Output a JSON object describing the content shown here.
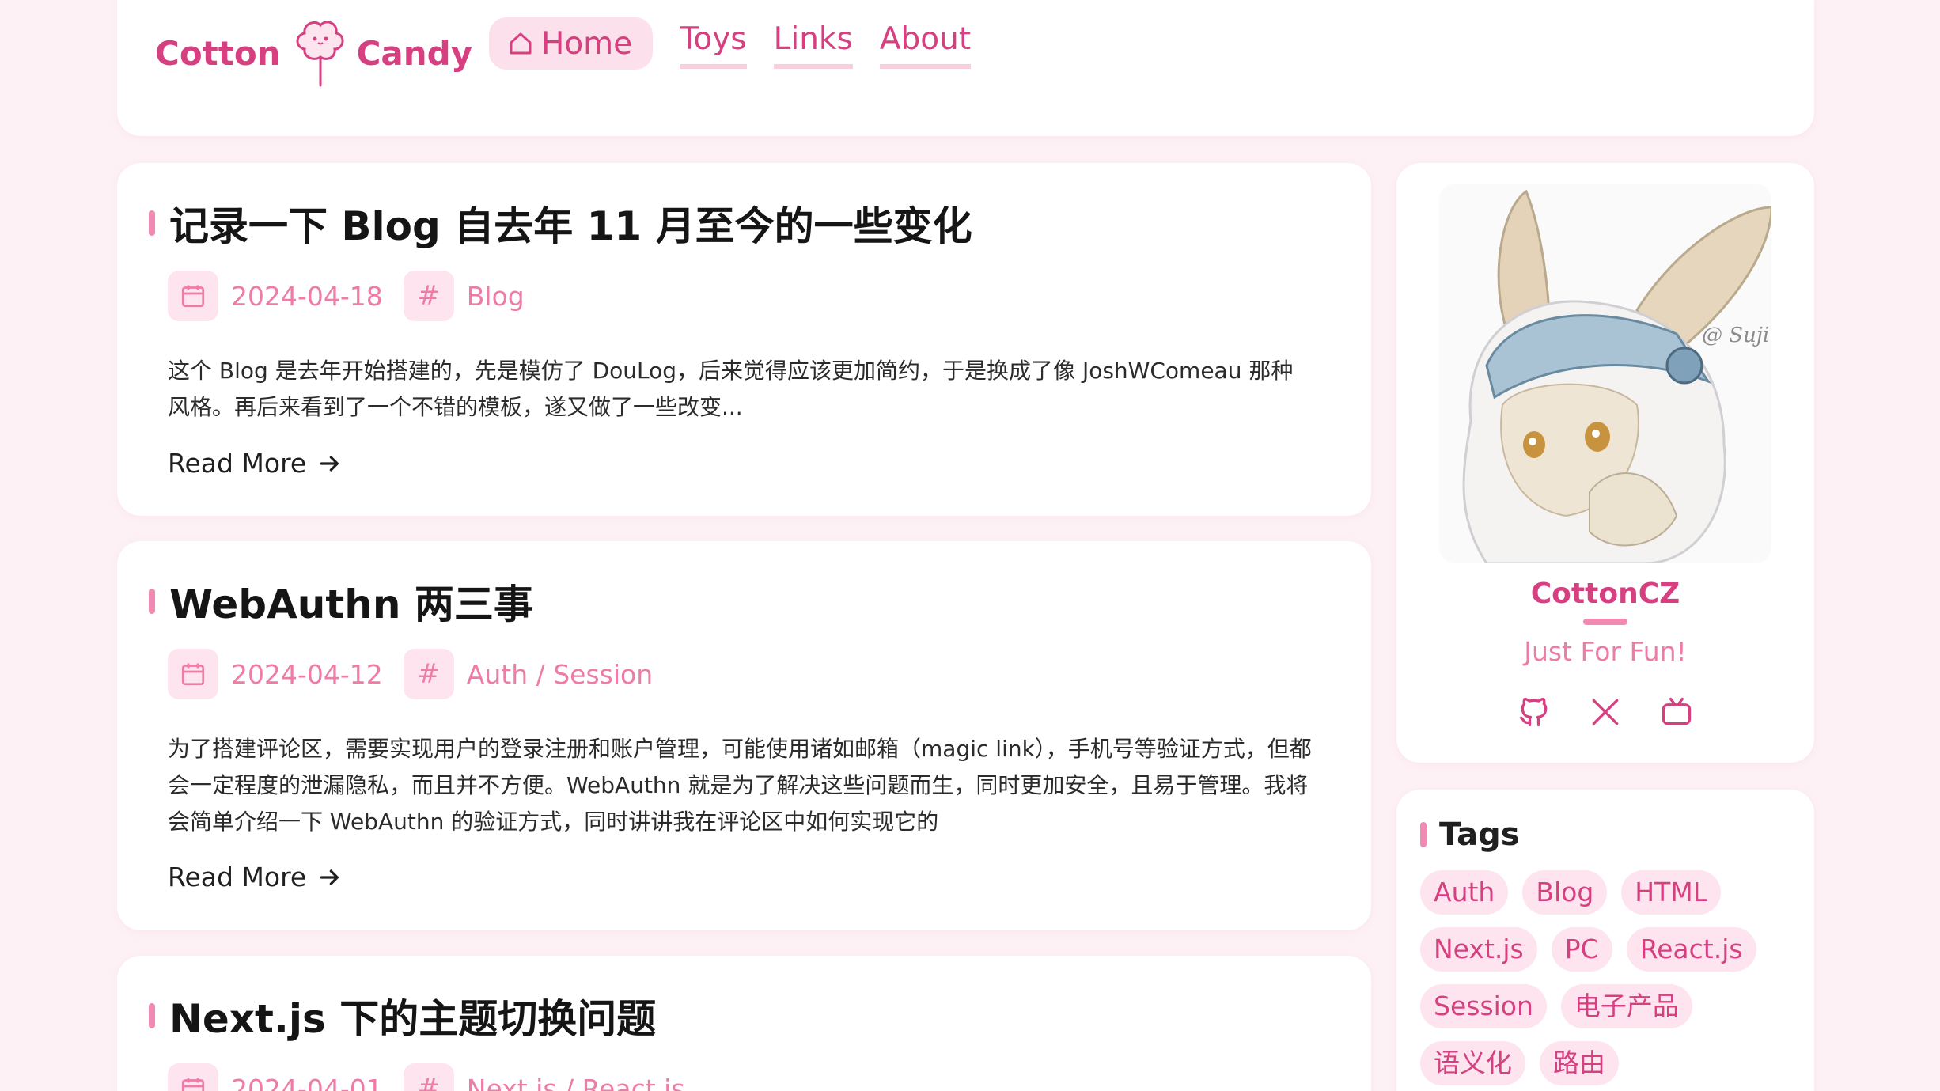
{
  "header": {
    "logo_left": "Cotton",
    "logo_right": "Candy",
    "nav": {
      "home": "Home",
      "toys": "Toys",
      "links": "Links",
      "about": "About"
    }
  },
  "posts": [
    {
      "title": "记录一下 Blog 自去年 11 月至今的一些变化",
      "date": "2024-04-18",
      "tags": "Blog",
      "excerpt": "这个 Blog 是去年开始搭建的，先是模仿了 DouLog，后来觉得应该更加简约，于是换成了像 JoshWComeau 那种风格。再后来看到了一个不错的模板，遂又做了一些改变...",
      "read_more": "Read More"
    },
    {
      "title": "WebAuthn 两三事",
      "date": "2024-04-12",
      "tags": "Auth / Session",
      "excerpt": "为了搭建评论区，需要实现用户的登录注册和账户管理，可能使用诸如邮箱（magic link），手机号等验证方式，但都会一定程度的泄漏隐私，而且并不方便。WebAuthn 就是为了解决这些问题而生，同时更加安全，且易于管理。我将会简单介绍一下 WebAuthn 的验证方式，同时讲讲我在评论区中如何实现它的",
      "read_more": "Read More"
    },
    {
      "title": "Next.js 下的主题切换问题",
      "date": "2024-04-01",
      "tags": "Next.js / React.js"
    }
  ],
  "profile": {
    "name": "CottonCZ",
    "motto": "Just For Fun!",
    "avatar_signature": "@ Suji",
    "socials": [
      "github-icon",
      "x-icon",
      "bilibili-icon"
    ]
  },
  "tags_panel": {
    "title": "Tags",
    "tags": [
      "Auth",
      "Blog",
      "HTML",
      "Next.js",
      "PC",
      "React.js",
      "Session",
      "电子产品",
      "语义化",
      "路由"
    ]
  },
  "colors": {
    "accent": "#d63f80",
    "accent_light": "#ef7ba7",
    "pill_bg": "#fde4ee",
    "page_bg": "#fdf1f5"
  }
}
